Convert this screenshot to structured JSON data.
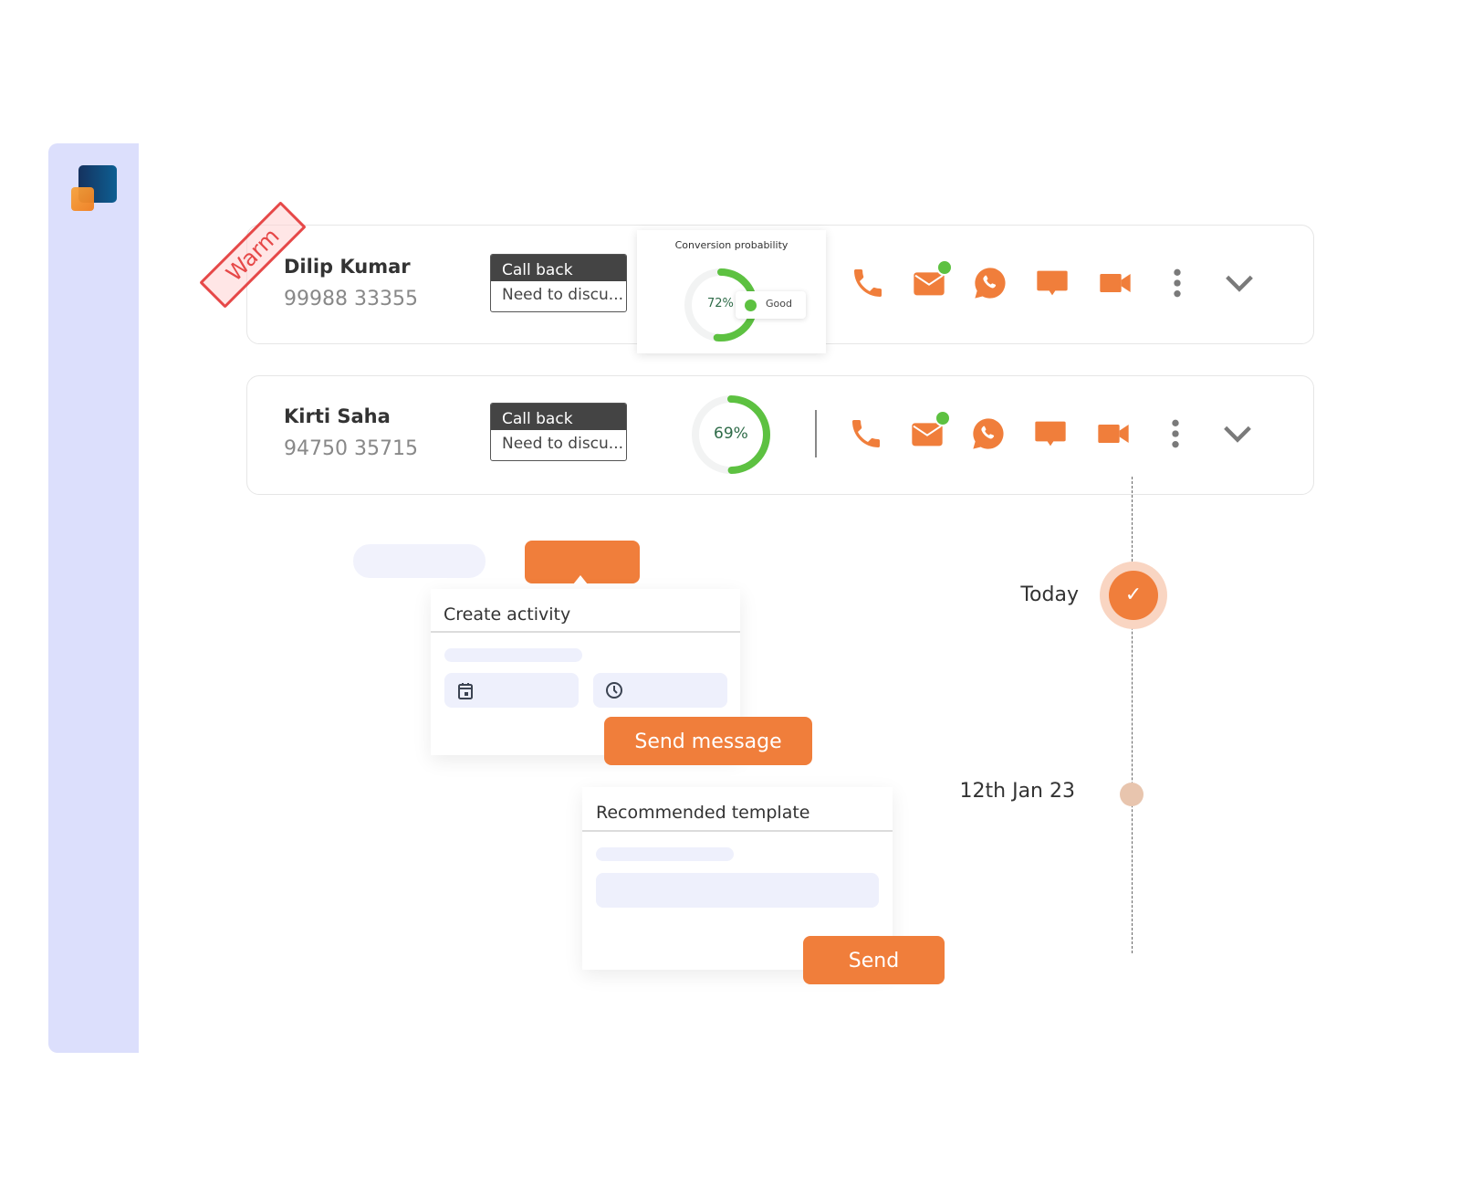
{
  "sidebar": {
    "logo": "brand-logo"
  },
  "leads": [
    {
      "tag": "Warm",
      "name": "Dilip Kumar",
      "phone": "99988 33355",
      "status": "Call back",
      "note": "Need to discu...",
      "conversion": {
        "title": "Conversion probability",
        "percent": 72,
        "label": "72%",
        "rating": "Good"
      },
      "mail_unread": true
    },
    {
      "name": "Kirti Saha",
      "phone": "94750 35715",
      "status": "Call back",
      "note": "Need to discu...",
      "conversion": {
        "percent": 69,
        "label": "69%"
      },
      "mail_unread": true
    }
  ],
  "actions": [
    "phone-icon",
    "mail-icon",
    "whatsapp-icon",
    "chat-icon",
    "video-icon",
    "more-vertical-icon",
    "chevron-down-icon"
  ],
  "create_activity": {
    "title": "Create activity",
    "date_icon": "calendar-icon",
    "time_icon": "clock-icon",
    "button": "Send message"
  },
  "recommended_template": {
    "title": "Recommended template",
    "button": "Send"
  },
  "timeline": [
    {
      "label": "Today",
      "done": true
    },
    {
      "label": "12th Jan 23",
      "done": false
    }
  ],
  "colors": {
    "accent": "#f07e3b",
    "success": "#5dc141",
    "sidebar": "#dcdffc",
    "warm_tag": "#e64848"
  }
}
